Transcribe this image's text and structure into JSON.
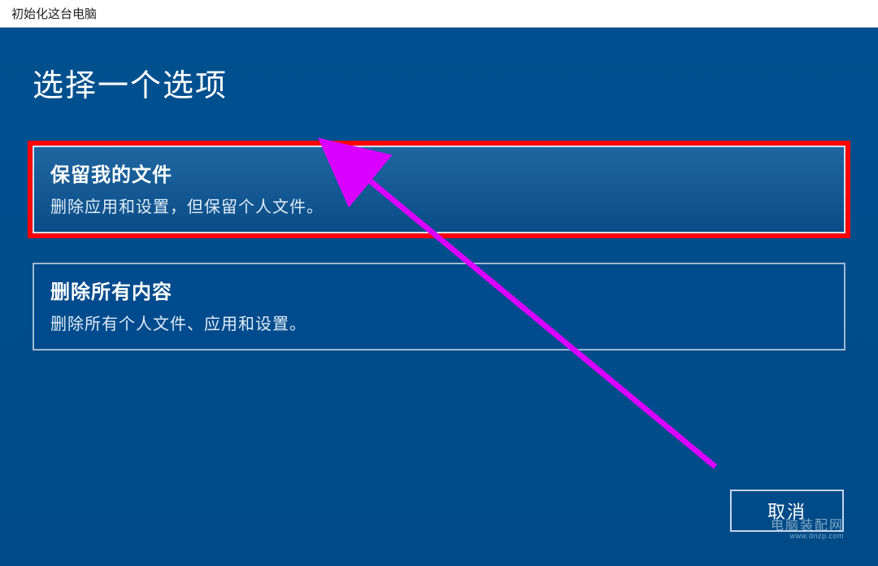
{
  "titlebar": {
    "title": "初始化这台电脑"
  },
  "heading": "选择一个选项",
  "options": [
    {
      "title": "保留我的文件",
      "description": "删除应用和设置，但保留个人文件。",
      "highlighted": true
    },
    {
      "title": "删除所有内容",
      "description": "删除所有个人文件、应用和设置。",
      "highlighted": false
    }
  ],
  "buttons": {
    "cancel": "取消"
  },
  "watermark": {
    "line1": "电脑装配网",
    "line2": "www.dnzp.com"
  },
  "colors": {
    "panel_bg": "#004b8d",
    "highlight_border": "#ff0000",
    "arrow": "#da00ff"
  }
}
